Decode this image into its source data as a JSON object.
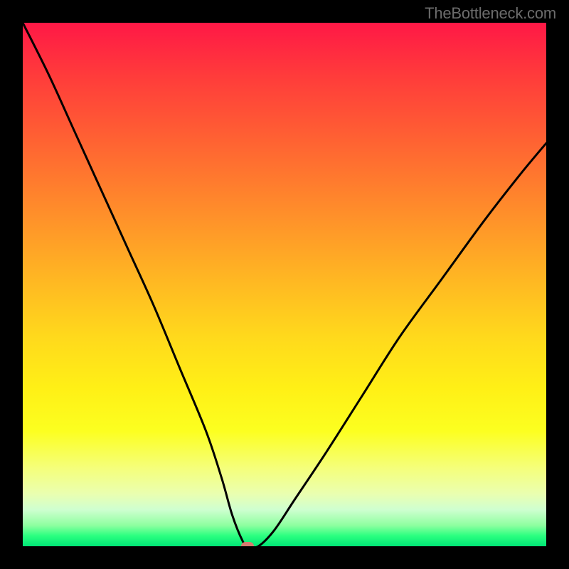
{
  "watermark": "TheBottleneck.com",
  "colors": {
    "frame": "#000000",
    "curve": "#000000",
    "marker": "#d67b6f",
    "gradient_top": "#ff1846",
    "gradient_bottom": "#00e676"
  },
  "chart_data": {
    "type": "line",
    "title": "",
    "xlabel": "",
    "ylabel": "",
    "xlim": [
      0,
      100
    ],
    "ylim": [
      0,
      100
    ],
    "grid": false,
    "legend": false,
    "annotations": [
      "TheBottleneck.com"
    ],
    "marker": {
      "x": 43,
      "y": 0
    },
    "series": [
      {
        "name": "bottleneck-curve",
        "x": [
          0,
          5,
          10,
          15,
          20,
          25,
          30,
          35,
          38,
          40,
          42,
          43,
          45,
          48,
          52,
          58,
          65,
          72,
          80,
          88,
          95,
          100
        ],
        "values": [
          100,
          90,
          79,
          68,
          57,
          46,
          34,
          22,
          13,
          6,
          1,
          0,
          0,
          3,
          9,
          18,
          29,
          40,
          51,
          62,
          71,
          77
        ]
      }
    ]
  }
}
